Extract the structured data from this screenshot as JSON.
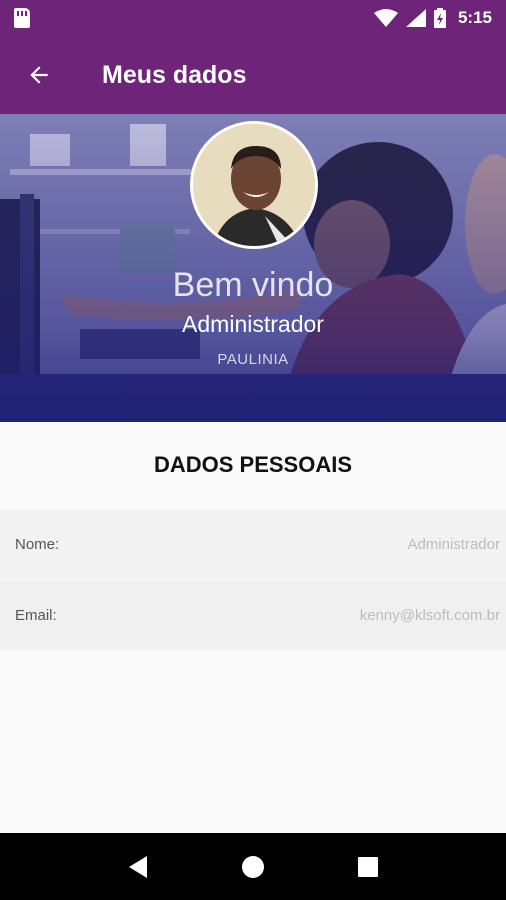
{
  "status_bar": {
    "time": "5:15",
    "icons": [
      "sd-card-icon",
      "wifi-icon",
      "signal-icon",
      "battery-charging-icon"
    ]
  },
  "app_bar": {
    "title": "Meus dados",
    "back_icon": "arrow-back-icon"
  },
  "profile": {
    "welcome": "Bem vindo",
    "role": "Administrador",
    "city": "PAULINIA"
  },
  "section": {
    "title": "DADOS PESSOAIS"
  },
  "fields": [
    {
      "label": "Nome:",
      "value": "Administrador"
    },
    {
      "label": "Email:",
      "value": "kenny@klsoft.com.br"
    }
  ],
  "nav": [
    "back-triangle-icon",
    "home-circle-icon",
    "recents-square-icon"
  ],
  "colors": {
    "primary": "#6e2479",
    "hero_overlay": "#2c2f86",
    "background": "#fafafa"
  }
}
